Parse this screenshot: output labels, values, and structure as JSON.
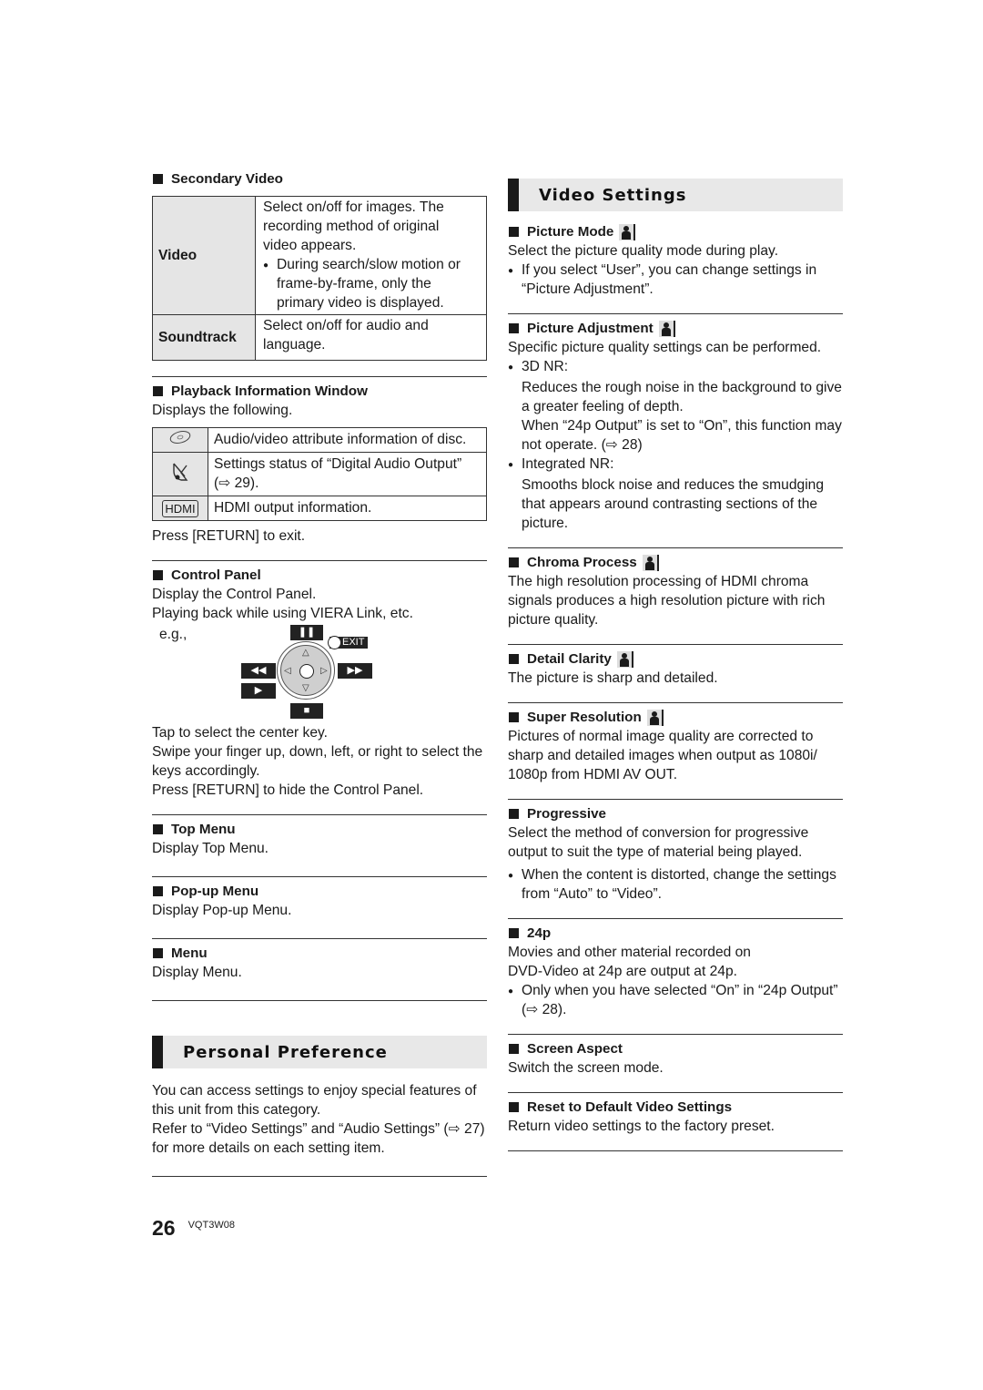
{
  "left": {
    "secondary_video": {
      "heading": "Secondary Video",
      "rows": [
        {
          "key": "Video",
          "lines": [
            "Select on/off for images. The",
            "recording method of original",
            "video appears."
          ],
          "bullet": "During search/slow motion or frame-by-frame, only the primary video is displayed."
        },
        {
          "key": "Soundtrack",
          "lines": [
            "Select on/off for audio and",
            "language."
          ]
        }
      ]
    },
    "playback_info": {
      "heading": "Playback Information Window",
      "intro": "Displays the following.",
      "rows": [
        {
          "icon": "disc-icon",
          "text": "Audio/video attribute information of disc."
        },
        {
          "icon": "digital-audio-icon",
          "text": "Settings status of “Digital Audio Output” (⇨ 29)."
        },
        {
          "icon": "hdmi-icon",
          "icon_label": "HDMI",
          "text": "HDMI output information."
        }
      ],
      "outro": "Press [RETURN] to exit."
    },
    "control_panel": {
      "heading": "Control Panel",
      "lines": [
        "Display the Control Panel.",
        "Playing back while using VIERA Link, etc."
      ],
      "example_label": "e.g.,",
      "buttons": {
        "pause": "❚❚",
        "rewind": "◀◀",
        "fast_forward": "▶▶",
        "play": "▶",
        "stop": "■",
        "exit": "EXIT"
      },
      "after_lines": [
        "Tap to select the center key.",
        "Swipe your finger up, down, left, or right to select the keys accordingly.",
        "Press [RETURN] to hide the Control Panel."
      ]
    },
    "top_menu": {
      "heading": "Top Menu",
      "text": "Display Top Menu."
    },
    "popup_menu": {
      "heading": "Pop-up Menu",
      "text": "Display Pop-up Menu."
    },
    "menu": {
      "heading": "Menu",
      "text": "Display Menu."
    },
    "personal_preference": {
      "title": "Personal Preference",
      "lines": [
        "You can access settings to enjoy special features of this unit from this category.",
        "Refer to “Video Settings” and “Audio Settings” (⇨ 27) for more details on each setting item."
      ]
    }
  },
  "right": {
    "title": "Video Settings",
    "picture_mode": {
      "heading": "Picture Mode",
      "text": "Select the picture quality mode during play.",
      "bullet": "If you select “User”, you can change settings in “Picture Adjustment”."
    },
    "picture_adjustment": {
      "heading": "Picture Adjustment",
      "text": "Specific picture quality settings can be performed.",
      "items": [
        {
          "label": "3D NR:",
          "lines": [
            "Reduces the rough noise in the background to give a greater feeling of depth.",
            "When “24p Output” is set to “On”, this function may not operate. (⇨ 28)"
          ]
        },
        {
          "label": "Integrated NR:",
          "lines": [
            "Smooths block noise and reduces the smudging that appears around contrasting sections of the picture."
          ]
        }
      ]
    },
    "chroma_process": {
      "heading": "Chroma Process",
      "text": "The high resolution processing of HDMI chroma signals produces a high resolution picture with rich picture quality."
    },
    "detail_clarity": {
      "heading": "Detail Clarity",
      "text": "The picture is sharp and detailed."
    },
    "super_resolution": {
      "heading": "Super Resolution",
      "text": "Pictures of normal image quality are corrected to sharp and detailed images when output as 1080i/ 1080p from HDMI AV OUT."
    },
    "progressive": {
      "heading": "Progressive",
      "text": "Select the method of conversion for progressive output to suit the type of material being played.",
      "bullet": "When the content is distorted, change the settings from “Auto” to “Video”."
    },
    "p24": {
      "heading": "24p",
      "lines": [
        "Movies and other material recorded on",
        "DVD-Video at 24p are output at 24p."
      ],
      "bullet": "Only when you have selected “On” in “24p Output” (⇨ 28)."
    },
    "screen_aspect": {
      "heading": "Screen Aspect",
      "text": "Switch the screen mode."
    },
    "reset": {
      "heading": "Reset to Default Video Settings",
      "text": "Return video settings to the factory preset."
    }
  },
  "footer": {
    "page_number": "26",
    "doc_code": "VQT3W08"
  }
}
